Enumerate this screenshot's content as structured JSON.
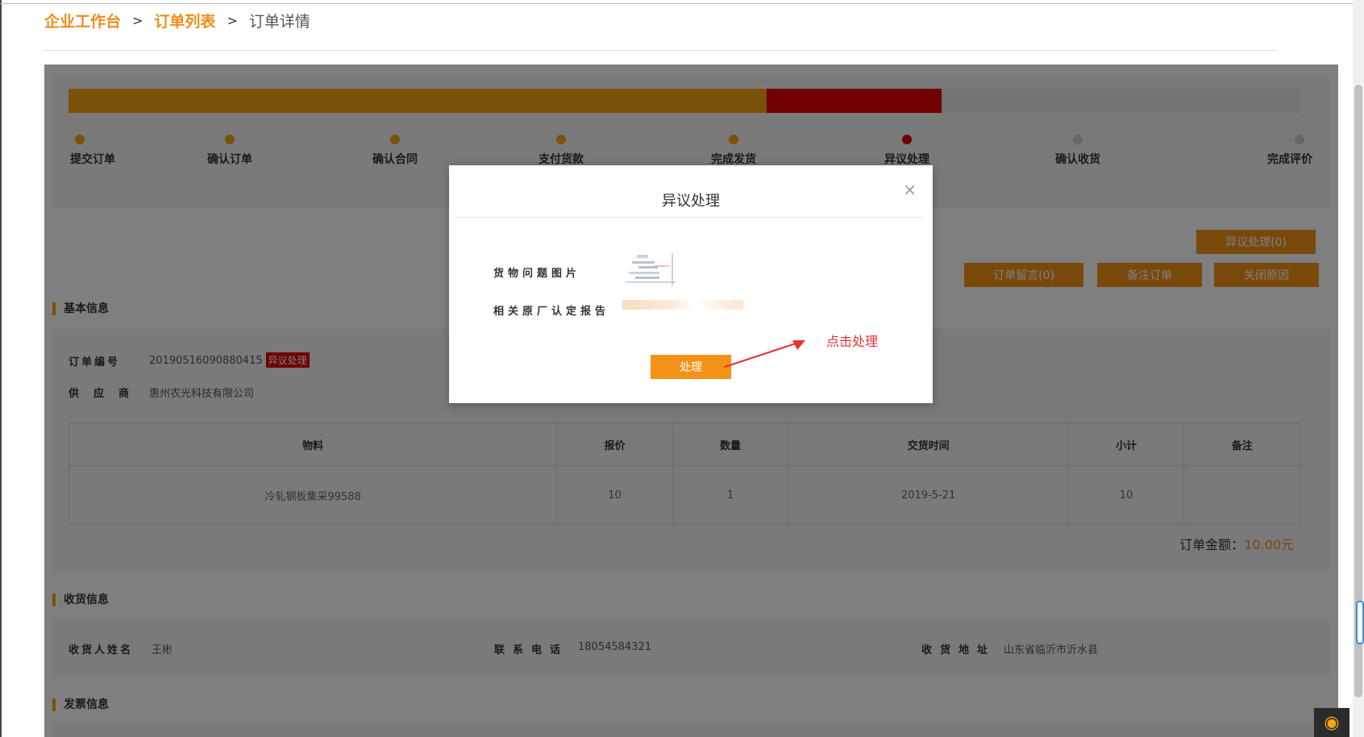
{
  "breadcrumb": {
    "home": "企业工作台",
    "list": "订单列表",
    "current": "订单详情",
    "separator": ">"
  },
  "progress": {
    "steps": [
      "提交订单",
      "确认订单",
      "确认合同",
      "支付货款",
      "完成发货",
      "异议处理",
      "确认收货",
      "完成评价"
    ],
    "current_step": "异议处理"
  },
  "actions": {
    "dispute": "异议处理(0)",
    "message": "订单留言(0)",
    "remark": "备注订单",
    "close_reason": "关闭原因"
  },
  "basic_info": {
    "title": "基本信息",
    "order_no_label": "订单编号",
    "order_no": "20190516090880415",
    "status_badge": "异议处理",
    "supplier_label": "供应商",
    "supplier": "惠州农光科技有限公司"
  },
  "items_table": {
    "headers": [
      "物料",
      "报价",
      "数量",
      "交货时间",
      "小计",
      "备注"
    ],
    "rows": [
      [
        "冷轧钢板集采99588",
        "10",
        "1",
        "2019-5-21",
        "10",
        ""
      ]
    ]
  },
  "order_total": {
    "label": "订单金额：",
    "amount": "10.00元"
  },
  "receiving_info": {
    "title": "收货信息",
    "name_label": "收货人姓名",
    "name": "王彬",
    "phone_label": "联系电话",
    "phone": "18054584321",
    "address_label": "收货地址",
    "address": "山东省临沂市沂水县"
  },
  "invoice_info": {
    "title": "发票信息"
  },
  "modal": {
    "title": "异议处理",
    "close": "×",
    "image_label": "货物问题图片",
    "report_label": "相关原厂认定报告",
    "submit": "处理"
  },
  "annotation": {
    "text": "点击处理"
  },
  "colors": {
    "accent": "#f29318",
    "alert": "#e00000",
    "annotation": "#e83030"
  }
}
